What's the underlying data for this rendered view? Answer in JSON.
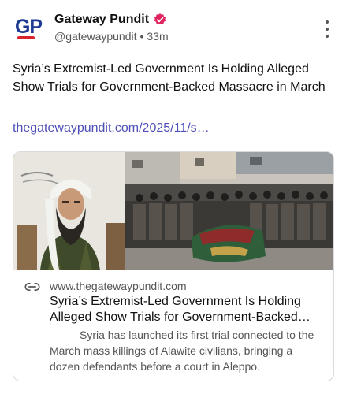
{
  "post": {
    "author_name": "Gateway Pundit",
    "avatar_text": "GP",
    "handle": "@gatewaypundit",
    "separator": "•",
    "time": "33m",
    "text": "Syria’s Extremist-Led Government Is Holding Alleged Show Trials for Government-Backed Massacre in March",
    "link": "thegatewaypundit.com/2025/11/s…"
  },
  "card": {
    "domain": "www.thegatewaypundit.com",
    "title": "Syria’s Extremist-Led Government Is Holding Alleged Show Trials for Government-Backed M…",
    "description": "Syria has launched its first trial connected to the March mass killings of Alawite civilians, bringing a dozen defendants before a court in Aleppo."
  },
  "colors": {
    "link": "#4e4fb8",
    "verified_badge": "#e0245e",
    "brand_blue": "#1f3a93",
    "brand_red": "#d9232d"
  },
  "icons": [
    "verified-badge-icon",
    "more-options-icon",
    "link-icon"
  ]
}
